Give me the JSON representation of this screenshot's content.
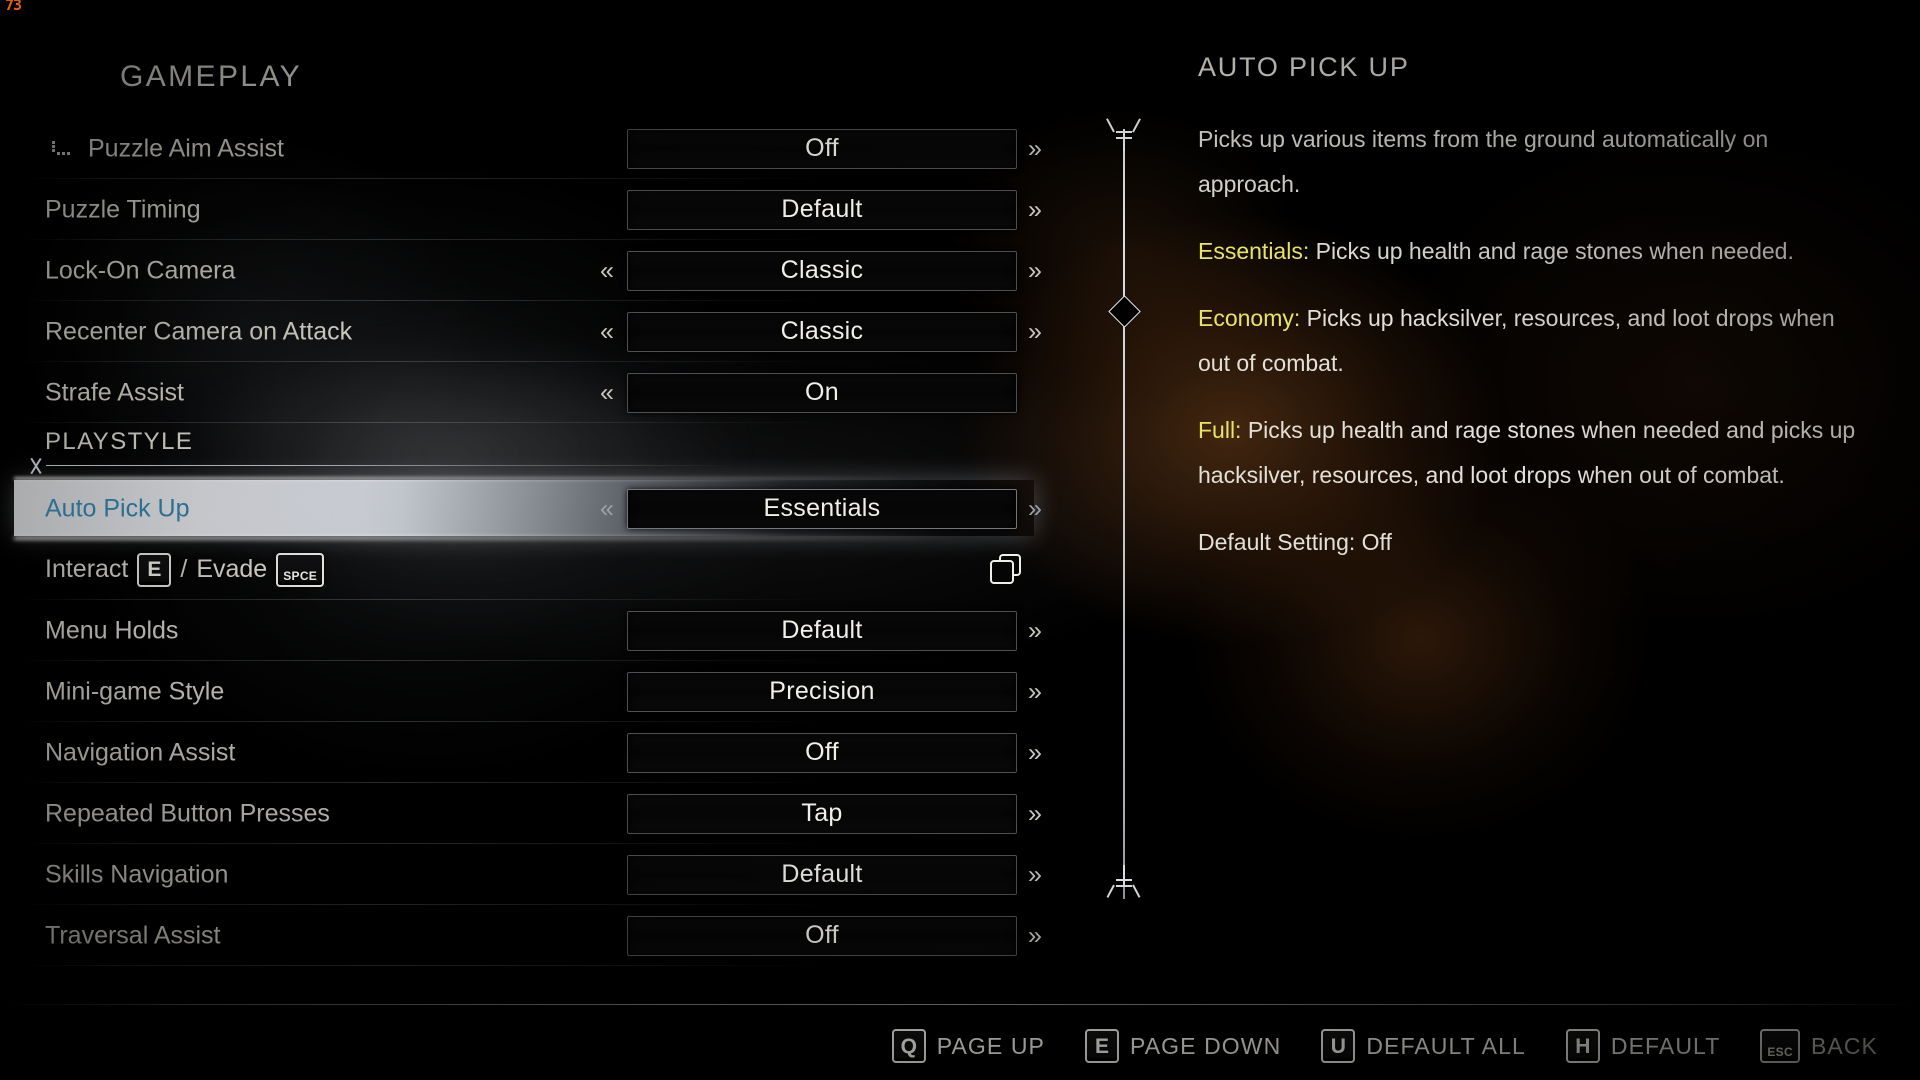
{
  "hud": {
    "fps": "73"
  },
  "page": {
    "title": "GAMEPLAY"
  },
  "settings": [
    {
      "label": "Puzzle Aim Assist",
      "value": "Off",
      "left_arrow": "",
      "right_arrow": "»",
      "icon": "dotted-corner-icon"
    },
    {
      "label": "Puzzle Timing",
      "value": "Default",
      "left_arrow": "",
      "right_arrow": "»"
    },
    {
      "label": "Lock-On Camera",
      "value": "Classic",
      "left_arrow": "«",
      "right_arrow": "»"
    },
    {
      "label": "Recenter Camera on Attack",
      "value": "Classic",
      "left_arrow": "«",
      "right_arrow": "»"
    },
    {
      "label": "Strafe Assist",
      "value": "On",
      "left_arrow": "«",
      "right_arrow": ""
    }
  ],
  "section": {
    "title": "PLAYSTYLE"
  },
  "selected_setting": {
    "label": "Auto Pick Up",
    "value": "Essentials",
    "left_arrow": "«",
    "right_arrow": "»"
  },
  "keybind_row": {
    "interact_label": "Interact",
    "interact_key": "E",
    "separator": "/",
    "evade_label": "Evade",
    "evade_key": "SPCE",
    "icon": "stacked-squares-icon"
  },
  "settings_lower": [
    {
      "label": "Menu Holds",
      "value": "Default",
      "left_arrow": "",
      "right_arrow": "»"
    },
    {
      "label": "Mini-game Style",
      "value": "Precision",
      "left_arrow": "",
      "right_arrow": "»"
    },
    {
      "label": "Navigation Assist",
      "value": "Off",
      "left_arrow": "",
      "right_arrow": "»"
    },
    {
      "label": "Repeated Button Presses",
      "value": "Tap",
      "left_arrow": "",
      "right_arrow": "»"
    },
    {
      "label": "Skills Navigation",
      "value": "Default",
      "left_arrow": "",
      "right_arrow": "»"
    },
    {
      "label": "Traversal Assist",
      "value": "Off",
      "left_arrow": "",
      "right_arrow": "»"
    }
  ],
  "info": {
    "title": "AUTO PICK UP",
    "intro": "Picks up various items from the ground automatically on approach.",
    "essentials_lead": "Essentials:",
    "essentials_text": " Picks up health and rage stones when needed.",
    "economy_lead": "Economy:",
    "economy_text": " Picks up hacksilver, resources, and loot drops when out of combat.",
    "full_lead": "Full:",
    "full_text": " Picks up health and rage stones when needed and picks up hacksilver, resources, and loot drops when out of combat.",
    "default_setting": "Default Setting: Off"
  },
  "footer_hints": [
    {
      "key": "Q",
      "label": "PAGE UP",
      "tiny": false
    },
    {
      "key": "E",
      "label": "PAGE DOWN",
      "tiny": false
    },
    {
      "key": "U",
      "label": "DEFAULT ALL",
      "tiny": false
    },
    {
      "key": "H",
      "label": "DEFAULT",
      "tiny": false
    },
    {
      "key": "ESC",
      "label": "BACK",
      "tiny": true
    }
  ],
  "colors": {
    "accent_selected_label": "#2c6f91",
    "accent_info_lead": "#e8e560",
    "fps": "#e8600f",
    "text": "#e3e0d8"
  }
}
